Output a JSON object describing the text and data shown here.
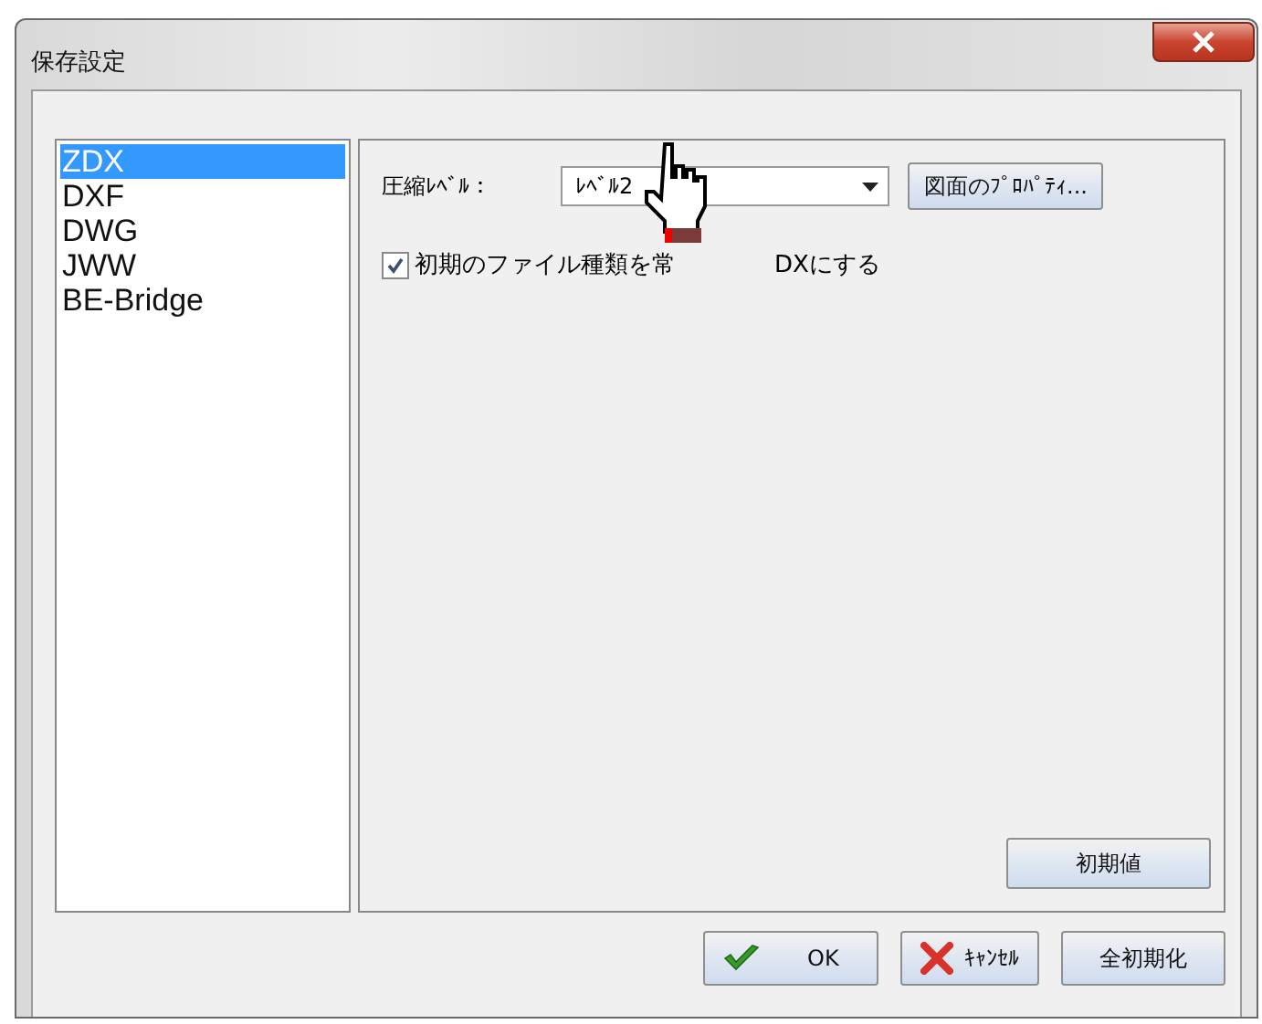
{
  "window": {
    "title": "保存設定"
  },
  "formats": [
    {
      "label": "ZDX",
      "selected": true
    },
    {
      "label": "DXF",
      "selected": false
    },
    {
      "label": "DWG",
      "selected": false
    },
    {
      "label": "JWW",
      "selected": false
    },
    {
      "label": "BE-Bridge",
      "selected": false
    }
  ],
  "compression": {
    "label": "圧縮ﾚﾍﾞﾙ：",
    "value": "ﾚﾍﾞﾙ2"
  },
  "properties_button": "図面のﾌﾟﾛﾊﾟﾃｨ...",
  "default_type_checkbox": {
    "label_before": "初期のファイル種類を常",
    "label_after": "DXにする",
    "checked": true
  },
  "defaults_button": "初期値",
  "buttons": [
    {
      "kind": "ok",
      "label": "OK"
    },
    {
      "kind": "cancel",
      "label": "ｷｬﾝｾﾙ"
    },
    {
      "kind": "plain",
      "label": "全初期化"
    }
  ]
}
